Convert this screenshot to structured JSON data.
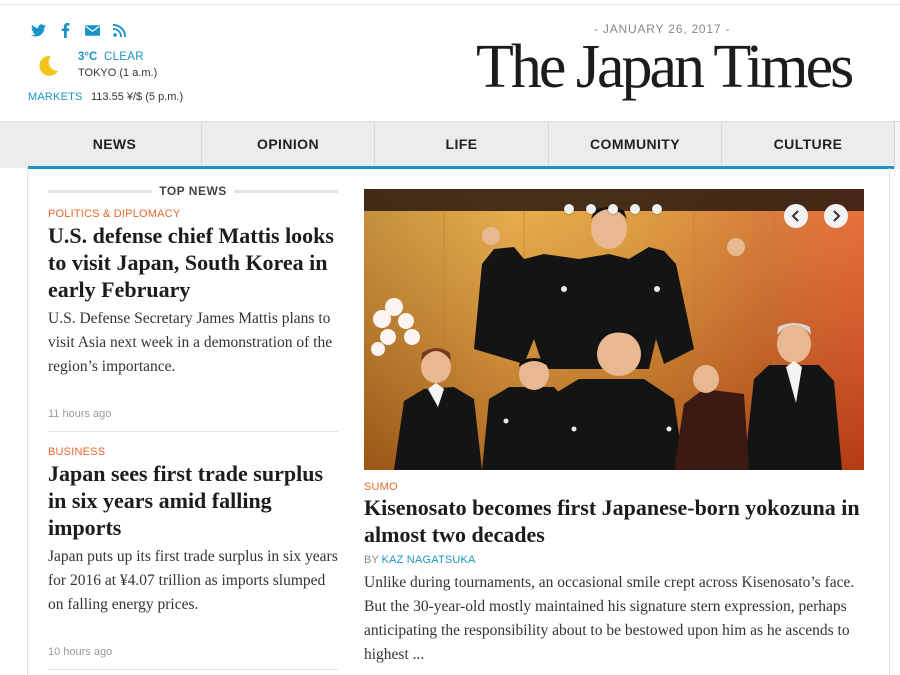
{
  "header": {
    "date": "- JANUARY 26, 2017 -",
    "logo": "The Japan Times",
    "social_icons": [
      "twitter-icon",
      "facebook-icon",
      "mail-icon",
      "rss-icon"
    ],
    "weather": {
      "temp": "3°C",
      "condition": "CLEAR",
      "location": "TOKYO (1 a.m.)",
      "icon": "moon-icon"
    },
    "markets": {
      "label": "MARKETS",
      "value": "113.55 ¥/$ (5 p.m.)"
    }
  },
  "nav": {
    "items": [
      "NEWS",
      "OPINION",
      "LIFE",
      "COMMUNITY",
      "CULTURE"
    ]
  },
  "top_news": {
    "heading": "TOP NEWS",
    "articles": [
      {
        "category": "POLITICS & DIPLOMACY",
        "title": "U.S. defense chief Mattis looks to visit Japan, South Korea in early February",
        "summary": "U.S. Defense Secretary James Mattis plans to visit Asia next week in a demonstration of the region’s importance.",
        "time": "11 hours ago"
      },
      {
        "category": "BUSINESS",
        "title": "Japan sees first trade surplus in six years amid falling imports",
        "summary": "Japan puts up its first trade surplus in six years for 2016 at ¥4.07 trillion as imports slumped on falling energy prices.",
        "time": "10 hours ago"
      }
    ]
  },
  "feature": {
    "category": "SUMO",
    "title": "Kisenosato becomes first Japanese-born yokozuna in almost two decades",
    "byline_prefix": "BY",
    "author": "KAZ NAGATSUKA",
    "summary": "Unlike during tournaments, an occasional smile crept across Kisenosato’s face. But the 30-year-old mostly maintained his signature stern expression, perhaps anticipating the responsibility about to be bestowed upon him as he ascends to highest ...",
    "slides": 5,
    "active_slide": 2
  },
  "colors": {
    "accent": "#1a94c8",
    "category": "#e5692a"
  }
}
